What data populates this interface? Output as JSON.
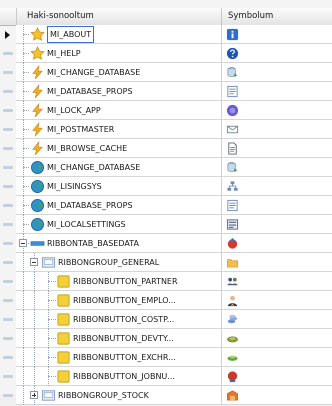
{
  "columns": {
    "name": "Haki-sonooltum",
    "symbol": "Symbolum"
  },
  "rows": [
    {
      "label": "MI_ABOUT",
      "level": 1,
      "icon": "star-icon",
      "sym": "info-icon"
    },
    {
      "label": "MI_HELP",
      "level": 1,
      "icon": "star-icon",
      "sym": "help-icon"
    },
    {
      "label": "MI_CHANGE_DATABASE",
      "level": 1,
      "icon": "lightning-icon",
      "sym": "database-change-icon"
    },
    {
      "label": "MI_DATABASE_PROPS",
      "level": 1,
      "icon": "lightning-icon",
      "sym": "properties-icon"
    },
    {
      "label": "MI_LOCK_APP",
      "level": 1,
      "icon": "lightning-icon",
      "sym": "lock-icon"
    },
    {
      "label": "MI_POSTMASTER",
      "level": 1,
      "icon": "lightning-icon",
      "sym": "mail-icon"
    },
    {
      "label": "MI_BROWSE_CACHE",
      "level": 1,
      "icon": "lightning-icon",
      "sym": "document-icon"
    },
    {
      "label": "MI_CHANGE_DATABASE",
      "level": 1,
      "icon": "globe-icon",
      "sym": "database-change-icon"
    },
    {
      "label": "MI_LISINGSYS",
      "level": 1,
      "icon": "globe-icon",
      "sym": "tree-icon"
    },
    {
      "label": "MI_DATABASE_PROPS",
      "level": 1,
      "icon": "globe-icon",
      "sym": "properties-icon"
    },
    {
      "label": "MI_LOCALSETTINGS",
      "level": 1,
      "icon": "globe-icon",
      "sym": "settings-icon"
    },
    {
      "label": "RIBBONTAB_BASEDATA",
      "level": 1,
      "icon": "ribbontab-icon",
      "sym": "ribbon-red-icon"
    },
    {
      "label": "RIBBONGROUP_GENERAL",
      "level": 2,
      "icon": "ribbongroup-icon",
      "sym": "folder-icon"
    },
    {
      "label": "RIBBONBUTTON_PARTNER",
      "level": 3,
      "icon": "button-square-icon",
      "sym": "partner-icon"
    },
    {
      "label": "RIBBONBUTTON_EMPLO...",
      "level": 3,
      "icon": "button-square-icon",
      "sym": "employee-icon"
    },
    {
      "label": "RIBBONBUTTON_COSTP...",
      "level": 3,
      "icon": "button-square-icon",
      "sym": "costcenter-icon"
    },
    {
      "label": "RIBBONBUTTON_DEVTY...",
      "level": 3,
      "icon": "button-square-icon",
      "sym": "device-icon"
    },
    {
      "label": "RIBBONBUTTON_EXCHR...",
      "level": 3,
      "icon": "button-square-icon",
      "sym": "exchange-icon"
    },
    {
      "label": "RIBBONBUTTON_JOBNU...",
      "level": 3,
      "icon": "button-square-icon",
      "sym": "job-icon"
    },
    {
      "label": "RIBBONGROUP_STOCK",
      "level": 2,
      "icon": "ribbongroup-icon",
      "sym": "stock-icon"
    }
  ]
}
